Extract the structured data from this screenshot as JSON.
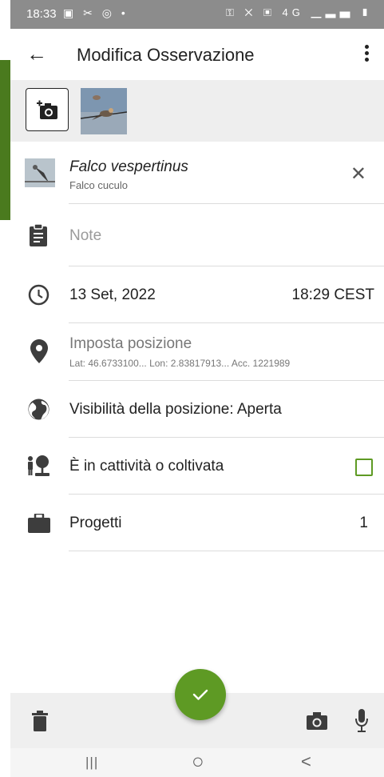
{
  "status_bar": {
    "time": "18:33",
    "left_icons": "▣ ✂ ◎ •",
    "right_icons": "⚿ ✕ ▣ 4G ▁▃▅ ▮"
  },
  "toolbar": {
    "title": "Modifica Osservazione"
  },
  "species": {
    "scientific_name": "Falco vespertinus",
    "common_name": "Falco cuculo"
  },
  "notes": {
    "placeholder": "Note"
  },
  "date_time": {
    "date": "13 Set, 2022",
    "time": "18:29 CEST"
  },
  "location": {
    "title": "Imposta posizione",
    "details": "Lat: 46.6733100... Lon: 2.83817913... Acc. 1221989"
  },
  "visibility": {
    "label": "Visibilità della posizione: Aperta"
  },
  "captive": {
    "label": "È in cattività o coltivata",
    "checked": false
  },
  "projects": {
    "label": "Progetti",
    "count": "1"
  },
  "nav": {
    "recents": "|||",
    "home": "○",
    "back": "<"
  },
  "colors": {
    "accent_green": "#5e9a24",
    "status_bar": "#8c8c8c"
  }
}
